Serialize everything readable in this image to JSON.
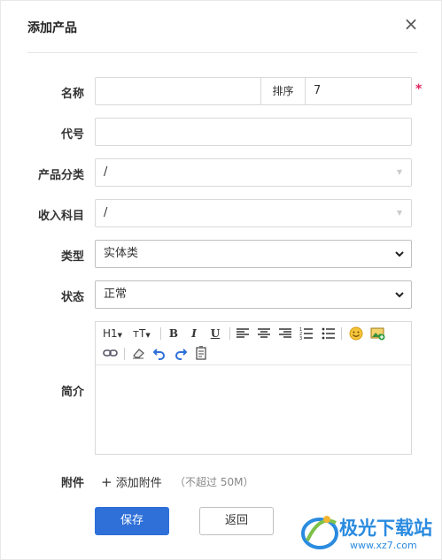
{
  "dialog": {
    "title": "添加产品",
    "close_glyph": "×"
  },
  "form": {
    "name": {
      "label": "名称",
      "value": "",
      "sort_label": "排序",
      "sort_value": "7",
      "required_mark": "*"
    },
    "code": {
      "label": "代号",
      "value": ""
    },
    "category": {
      "label": "产品分类",
      "value": "/"
    },
    "income_subject": {
      "label": "收入科目",
      "value": "/"
    },
    "type": {
      "label": "类型",
      "value": "实体类"
    },
    "status": {
      "label": "状态",
      "value": "正常"
    },
    "intro": {
      "label": "简介"
    },
    "attachment": {
      "label": "附件",
      "add_label": "添加附件",
      "hint": "（不超过 50M）"
    }
  },
  "toolbar": {
    "heading": "H1",
    "font_size": "тT",
    "bold": "B",
    "italic": "I",
    "underline": "U",
    "icons": [
      "align-left-icon",
      "align-center-icon",
      "align-right-icon",
      "ordered-list-icon",
      "unordered-list-icon",
      "emoji-icon",
      "image-icon",
      "link-icon",
      "eraser-icon",
      "undo-icon",
      "redo-icon",
      "paste-icon"
    ]
  },
  "buttons": {
    "save": "保存",
    "back": "返回"
  },
  "watermark": {
    "text": "极光下载站",
    "url": "www.xz7.com",
    "color": "#2a8be0"
  },
  "colors": {
    "primary": "#2e6fd8",
    "required": "#e0245e"
  }
}
